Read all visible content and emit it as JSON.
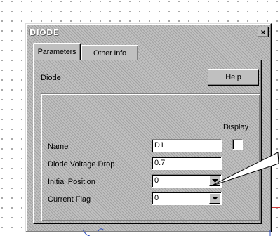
{
  "dialog": {
    "title": "DIODE",
    "close_glyph": "×",
    "close_icon": "close-icon"
  },
  "tabs": [
    {
      "label": "Parameters",
      "active": true
    },
    {
      "label": "Other Info",
      "active": false
    }
  ],
  "panel": {
    "component_label": "Diode",
    "help_label": "Help",
    "display_label": "Display",
    "display_checked": false
  },
  "fields": {
    "name": {
      "label": "Name",
      "value": "D1"
    },
    "voltage_drop": {
      "label": "Diode Voltage Drop",
      "value": "0.7"
    },
    "initial_position": {
      "label": "Initial Position",
      "value": "0"
    },
    "current_flag": {
      "label": "Current Flag",
      "value": "0"
    }
  },
  "icons": {
    "dropdown": "chevron-down-icon",
    "pointer": "callout-pointer-icon"
  },
  "colors": {
    "dialog_face": "#c0c0c0",
    "titlebar_text": "#ffffff",
    "field_bg": "#ffffff",
    "accent_red": "#d04040"
  }
}
